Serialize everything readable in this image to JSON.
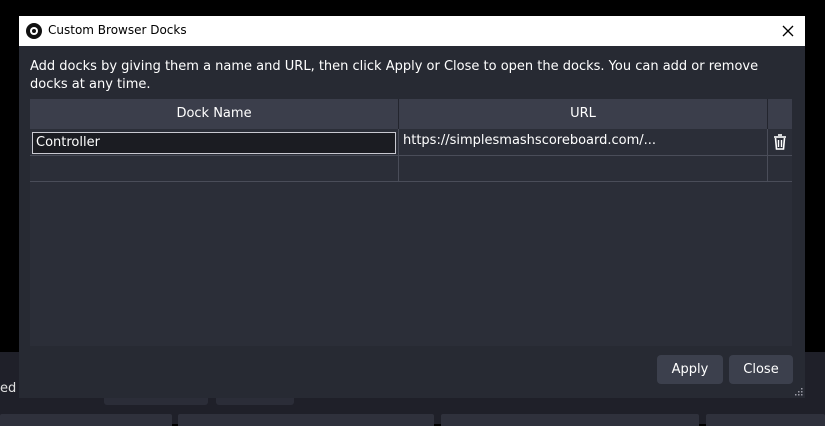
{
  "background": {
    "partial_text": "ed"
  },
  "dialog": {
    "title": "Custom Browser Docks",
    "description": "Add docks by giving them a name and URL, then click Apply or Close to open the docks. You can add or remove docks at any time.",
    "table": {
      "headers": [
        "Dock Name",
        "URL"
      ],
      "rows": [
        {
          "name": "Controller",
          "url": "https://simplesmashscoreboard.com/..."
        },
        {
          "name": "",
          "url": ""
        }
      ]
    },
    "buttons": {
      "apply": "Apply",
      "close": "Close"
    }
  },
  "colors": {
    "dialog_bg": "#272a33",
    "header_bg": "#3b3e4b",
    "button_bg": "#3c404d"
  }
}
